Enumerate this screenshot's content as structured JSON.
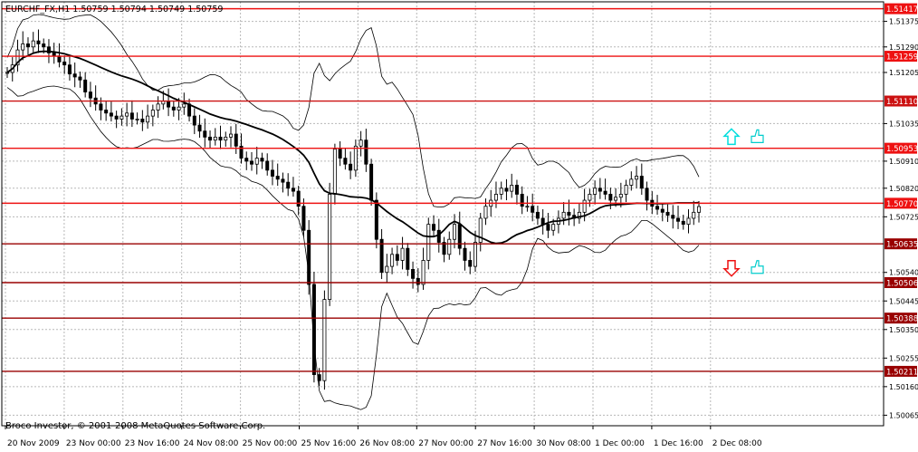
{
  "chart_data": {
    "type": "candlestick",
    "title": "EURCHF_FX,H1  1.50759 1.50794 1.50749 1.50759",
    "copyright": "Broco Investor, © 2001-2008 MetaQuotes Software Corp.",
    "ylim": [
      1.5003,
      1.5144
    ],
    "grid": true,
    "price_ticks": [
      "1.51375",
      "1.51290",
      "1.51205",
      "1.51035",
      "1.50910",
      "1.50820",
      "1.50725",
      "1.50540",
      "1.50445",
      "1.50350",
      "1.50255",
      "1.50160",
      "1.50065"
    ],
    "time_labels": [
      "20 Nov 2009",
      "23 Nov 00:00",
      "23 Nov 16:00",
      "24 Nov 08:00",
      "25 Nov 00:00",
      "25 Nov 16:00",
      "26 Nov 08:00",
      "27 Nov 00:00",
      "27 Nov 16:00",
      "30 Nov 08:00",
      "1 Dec 00:00",
      "1 Dec 16:00",
      "2 Dec 08:00"
    ],
    "levels": [
      {
        "price": "1.51417",
        "value": 1.51417,
        "color": "#ee1111"
      },
      {
        "price": "1.51259",
        "value": 1.51259,
        "color": "#ee1111"
      },
      {
        "price": "1.51110",
        "value": 1.5111,
        "color": "#cc1111"
      },
      {
        "price": "1.50953",
        "value": 1.50953,
        "color": "#ee1111"
      },
      {
        "price": "1.50770",
        "value": 1.5077,
        "color": "#ee1111"
      },
      {
        "price": "1.50635",
        "value": 1.50635,
        "color": "#990000"
      },
      {
        "price": "1.50506",
        "value": 1.50506,
        "color": "#990000"
      },
      {
        "price": "1.50388",
        "value": 1.50388,
        "color": "#990000"
      },
      {
        "price": "1.50211",
        "value": 1.50211,
        "color": "#990000"
      }
    ],
    "signals": [
      {
        "direction": "up",
        "at_price": 1.5099,
        "arrow_color": "#00dddd",
        "hand_color": "#00cccc"
      },
      {
        "direction": "down",
        "at_price": 1.50555,
        "arrow_color": "#ee1111",
        "hand_color": "#00cccc"
      }
    ],
    "close_series": [
      1.51205,
      1.5123,
      1.5128,
      1.513,
      1.5129,
      1.5131,
      1.513,
      1.5129,
      1.5127,
      1.5126,
      1.5124,
      1.5123,
      1.512,
      1.5119,
      1.5118,
      1.5114,
      1.5112,
      1.511,
      1.5108,
      1.5107,
      1.5106,
      1.5105,
      1.5106,
      1.5107,
      1.5105,
      1.5105,
      1.5104,
      1.5106,
      1.5108,
      1.511,
      1.5111,
      1.5109,
      1.5108,
      1.5109,
      1.511,
      1.5106,
      1.5103,
      1.5101,
      1.5099,
      1.5098,
      1.5099,
      1.5098,
      1.5099,
      1.51,
      1.5096,
      1.5092,
      1.5091,
      1.509,
      1.5092,
      1.5091,
      1.5088,
      1.5086,
      1.5085,
      1.5084,
      1.5082,
      1.5081,
      1.5076,
      1.5068,
      1.505,
      1.502,
      1.5018,
      1.5045,
      1.508,
      1.5095,
      1.5092,
      1.509,
      1.5088,
      1.5096,
      1.5098,
      1.509,
      1.5078,
      1.5065,
      1.5054,
      1.5056,
      1.506,
      1.5058,
      1.5062,
      1.5055,
      1.5052,
      1.505,
      1.5058,
      1.507,
      1.5068,
      1.5064,
      1.506,
      1.5065,
      1.507,
      1.5062,
      1.5058,
      1.5056,
      1.5064,
      1.5072,
      1.5076,
      1.5078,
      1.508,
      1.5082,
      1.5081,
      1.5083,
      1.508,
      1.5076,
      1.5076,
      1.5074,
      1.5072,
      1.507,
      1.5068,
      1.507,
      1.5072,
      1.5074,
      1.5073,
      1.5072,
      1.5074,
      1.5078,
      1.508,
      1.5082,
      1.5081,
      1.508,
      1.5078,
      1.5079,
      1.508,
      1.5083,
      1.5085,
      1.5086,
      1.5082,
      1.5078,
      1.5076,
      1.5075,
      1.5074,
      1.5073,
      1.5072,
      1.5071,
      1.507,
      1.5072,
      1.5074,
      1.50759
    ]
  }
}
